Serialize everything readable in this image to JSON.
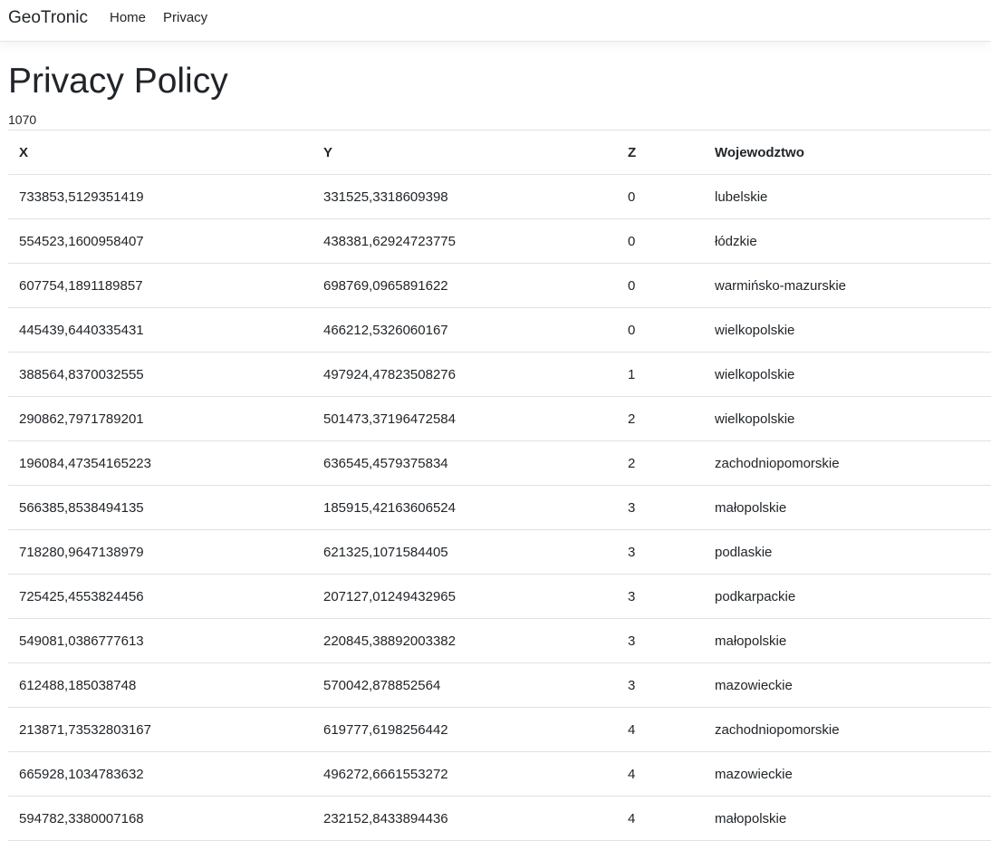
{
  "navbar": {
    "brand": "GeoTronic",
    "links": [
      {
        "label": "Home"
      },
      {
        "label": "Privacy"
      }
    ]
  },
  "page": {
    "title": "Privacy Policy",
    "count": "1070"
  },
  "table": {
    "headers": [
      "X",
      "Y",
      "Z",
      "Wojewodztwo"
    ],
    "rows": [
      [
        "733853,5129351419",
        "331525,3318609398",
        "0",
        "lubelskie"
      ],
      [
        "554523,1600958407",
        "438381,62924723775",
        "0",
        "łódzkie"
      ],
      [
        "607754,1891189857",
        "698769,0965891622",
        "0",
        "warmińsko-mazurskie"
      ],
      [
        "445439,6440335431",
        "466212,5326060167",
        "0",
        "wielkopolskie"
      ],
      [
        "388564,8370032555",
        "497924,47823508276",
        "1",
        "wielkopolskie"
      ],
      [
        "290862,7971789201",
        "501473,37196472584",
        "2",
        "wielkopolskie"
      ],
      [
        "196084,47354165223",
        "636545,4579375834",
        "2",
        "zachodniopomorskie"
      ],
      [
        "566385,8538494135",
        "185915,42163606524",
        "3",
        "małopolskie"
      ],
      [
        "718280,9647138979",
        "621325,1071584405",
        "3",
        "podlaskie"
      ],
      [
        "725425,4553824456",
        "207127,01249432965",
        "3",
        "podkarpackie"
      ],
      [
        "549081,0386777613",
        "220845,38892003382",
        "3",
        "małopolskie"
      ],
      [
        "612488,185038748",
        "570042,878852564",
        "3",
        "mazowieckie"
      ],
      [
        "213871,73532803167",
        "619777,6198256442",
        "4",
        "zachodniopomorskie"
      ],
      [
        "665928,1034783632",
        "496272,6661553272",
        "4",
        "mazowieckie"
      ],
      [
        "594782,3380007168",
        "232152,8433894436",
        "4",
        "małopolskie"
      ]
    ]
  }
}
